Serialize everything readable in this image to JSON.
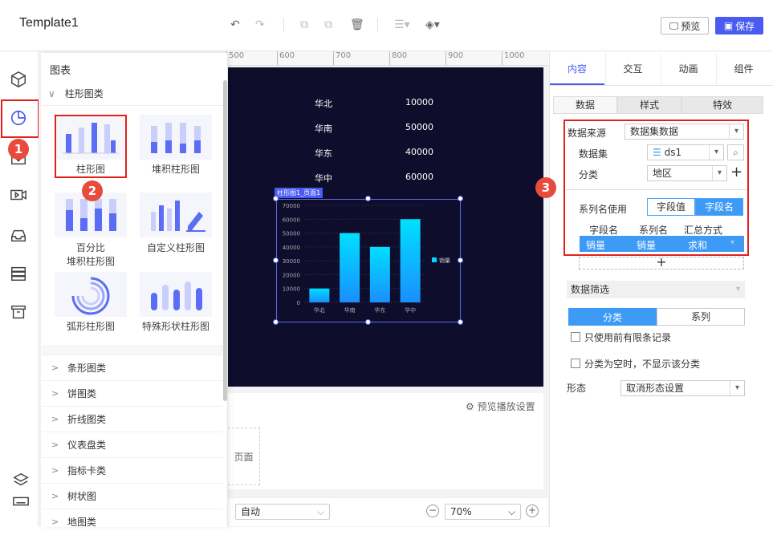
{
  "app": {
    "title": "Template1"
  },
  "toolbar": {
    "preview_label": "预览",
    "save_label": "保存"
  },
  "ruler": {
    "ticks": [
      "500",
      "600",
      "700",
      "800",
      "900",
      "1000"
    ]
  },
  "stage": {
    "rows": [
      {
        "region": "华北",
        "value": "10000"
      },
      {
        "region": "华南",
        "value": "50000"
      },
      {
        "region": "华东",
        "value": "40000"
      },
      {
        "region": "华中",
        "value": "60000"
      }
    ],
    "chart_label": "柱形图1_页面1"
  },
  "chart_data": {
    "type": "bar",
    "categories": [
      "华北",
      "华南",
      "华东",
      "华中"
    ],
    "values": [
      10000,
      50000,
      40000,
      60000
    ],
    "ylim": [
      0,
      70000
    ],
    "yticks": [
      "70000",
      "60000",
      "50000",
      "40000",
      "30000",
      "20000",
      "10000",
      "0"
    ],
    "legend": "销量",
    "bar_color_top": "#00e0ff",
    "bar_color_bottom": "#1a8fff",
    "grid": true,
    "legend_position": "right"
  },
  "panel": {
    "title": "图表",
    "bar_category": "柱形图类",
    "tiles": [
      {
        "label": "柱形图"
      },
      {
        "label": "堆积柱形图"
      },
      {
        "label": "百分比",
        "label2": "堆积柱形图"
      },
      {
        "label": "自定义柱形图"
      },
      {
        "label": "弧形柱形图"
      },
      {
        "label": "特殊形状柱形图"
      }
    ],
    "categories": [
      "条形图类",
      "饼图类",
      "折线图类",
      "仪表盘类",
      "指标卡类",
      "树状图",
      "地图类"
    ]
  },
  "bottom": {
    "preview_settings": "预览播放设置",
    "page_label": "页面",
    "auto_select": "自动",
    "zoom_select": "70%"
  },
  "callouts": [
    "1",
    "2",
    "3"
  ],
  "right": {
    "tabs": [
      "内容",
      "交互",
      "动画",
      "组件"
    ],
    "subtabs": [
      "数据",
      "样式",
      "特效"
    ],
    "datasource_label": "数据来源",
    "datasource_value": "数据集数据",
    "dataset_label": "数据集",
    "dataset_value": "ds1",
    "category_label": "分类",
    "category_value": "地区",
    "series_label": "系列名使用",
    "seg_value": "字段值",
    "seg_name": "字段名",
    "table_headers": [
      "字段名",
      "系列名",
      "汇总方式"
    ],
    "table_row": [
      "销量",
      "销量",
      "求和"
    ],
    "add_symbol": "+",
    "filter_label": "数据筛选",
    "seg_cat": "分类",
    "seg_series": "系列",
    "check1": "只使用前有限条记录",
    "check2": "分类为空时，不显示该分类",
    "shape_label": "形态",
    "shape_value": "取消形态设置"
  }
}
